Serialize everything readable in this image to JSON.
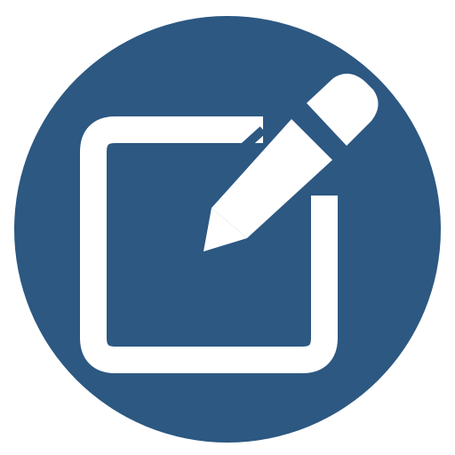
{
  "icon": {
    "name": "edit-icon",
    "colors": {
      "circle": "#2c5882",
      "glyph": "#ffffff",
      "background": "#ffffff"
    }
  }
}
